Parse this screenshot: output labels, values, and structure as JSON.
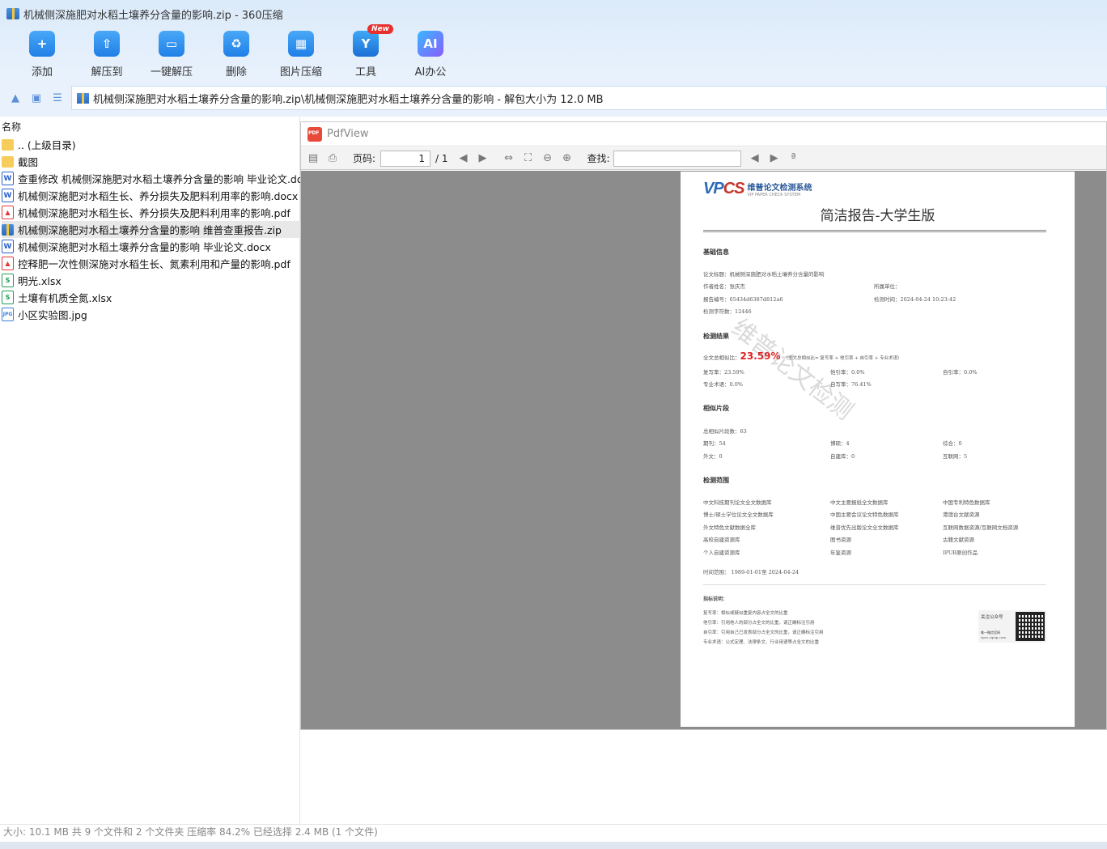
{
  "window": {
    "title": "机械侧深施肥对水稻土壤养分含量的影响.zip - 360压缩"
  },
  "toolbar": [
    {
      "label": "添加",
      "icon": "add-icon",
      "glyph": "+"
    },
    {
      "label": "解压到",
      "icon": "extract-to-icon",
      "glyph": "⇧"
    },
    {
      "label": "一键解压",
      "icon": "one-click-extract-icon",
      "glyph": "▭"
    },
    {
      "label": "删除",
      "icon": "delete-icon",
      "glyph": "♻"
    },
    {
      "label": "图片压缩",
      "icon": "image-compress-icon",
      "glyph": "▦"
    },
    {
      "label": "工具",
      "icon": "tools-icon",
      "glyph": "Y",
      "badge": "New"
    },
    {
      "label": "AI办公",
      "icon": "ai-office-icon",
      "glyph": "AI"
    }
  ],
  "address": {
    "path": "机械侧深施肥对水稻土壤养分含量的影响.zip\\机械侧深施肥对水稻土壤养分含量的影响 - 解包大小为 12.0 MB"
  },
  "filelist": {
    "header": "名称",
    "items": [
      {
        "name": ".. (上级目录)",
        "type": "folder"
      },
      {
        "name": "截图",
        "type": "folder"
      },
      {
        "name": "查重修改 机械侧深施肥对水稻土壤养分含量的影响  毕业论文.docx",
        "type": "docx"
      },
      {
        "name": "机械侧深施肥对水稻生长、养分损失及肥料利用率的影响.docx",
        "type": "docx"
      },
      {
        "name": "机械侧深施肥对水稻生长、养分损失及肥料利用率的影响.pdf",
        "type": "pdf"
      },
      {
        "name": "机械侧深施肥对水稻土壤养分含量的影响   维普查重报告.zip",
        "type": "zip",
        "selected": true
      },
      {
        "name": "机械侧深施肥对水稻土壤养分含量的影响  毕业论文.docx",
        "type": "docx"
      },
      {
        "name": "控释肥一次性侧深施对水稻生长、氮素利用和产量的影响.pdf",
        "type": "pdf"
      },
      {
        "name": "明光.xlsx",
        "type": "xlsx"
      },
      {
        "name": "土壤有机质全氮.xlsx",
        "type": "xlsx"
      },
      {
        "name": "小区实验图.jpg",
        "type": "jpg"
      }
    ]
  },
  "pdfview": {
    "title": "PdfView",
    "page_label": "页码:",
    "page_current": "1",
    "page_total": "/ 1",
    "find_label": "查找:"
  },
  "report": {
    "logo_mark": "VP",
    "logo_mark2": "CS",
    "logo_cn": "维普论文检测系统",
    "logo_en": "VIP PAPER CHECK SYSTEM",
    "title": "简洁报告-大学生版",
    "sec_basic": "基础信息",
    "paper_title": "论文标题：机械侧深施肥对水稻土壤养分含量的影响",
    "author": "作者姓名：张庆杰",
    "unit": "所属单位：",
    "report_no": "报告编号：65434d6387d812a6",
    "check_time": "检测时间：2024-04-24 10:23:42",
    "char_count": "检测字符数：12446",
    "sec_result": "检测结果",
    "total_label": "全文总相似比：",
    "total_value": "23.59%",
    "total_formula": "（全文总相似比= 复写率 + 他引率 + 自引率 + 专业术语）",
    "copy_rate": "复写率：23.59%",
    "other_cite": "他引率：0.0%",
    "self_cite": "自引率：0.0%",
    "term_rate": "专业术语：0.0%",
    "self_write": "自写率：76.41%",
    "sec_fragments": "相似片段",
    "frag_total": "总相似片段数：63",
    "frag_journal": "期刊：54",
    "frag_thesis": "博硕：4",
    "frag_general": "综合：0",
    "frag_foreign": "外文：0",
    "frag_selfbuilt": "自建库：0",
    "frag_internet": "互联网：5",
    "sec_scope": "检测范围",
    "scope": [
      [
        "中文科技期刊论文全文数据库",
        "中文主要报纸全文数据库",
        "中国专利特色数据库"
      ],
      [
        "博士/硕士学位论文全文数据库",
        "中国主要会议论文特色数据库",
        "港澳台文献资源"
      ],
      [
        "外文特色文献数据全库",
        "维普优先出版论文全文数据库",
        "互联网数据资源/互联网文档资源"
      ],
      [
        "高校自建资源库",
        "图书资源",
        "古籍文献资源"
      ],
      [
        "个人自建资源库",
        "年鉴资源",
        "IPUB原创作品"
      ]
    ],
    "time_range": "时间范围： 1989-01-01至 2024-04-24",
    "sec_notes": "指标说明：",
    "notes": [
      "复写率：相似或疑似重复内容占全文的比重",
      "他引率：引用他人的部分占全文的比重，请正确标注引用",
      "自引率：引用自己已发表部分占全文的比重，请正确标注引用",
      "专业术语：公式定理、法律条文、行业用语等占全文的比重"
    ],
    "follow": "关注公众号",
    "official": "唯一微信官网",
    "official_url": "vpcs.cqvip.com",
    "watermark": "维普论文检测"
  },
  "status": {
    "text": "大小: 10.1 MB 共 9 个文件和 2 个文件夹 压缩率 84.2% 已经选择 2.4 MB (1 个文件)"
  }
}
